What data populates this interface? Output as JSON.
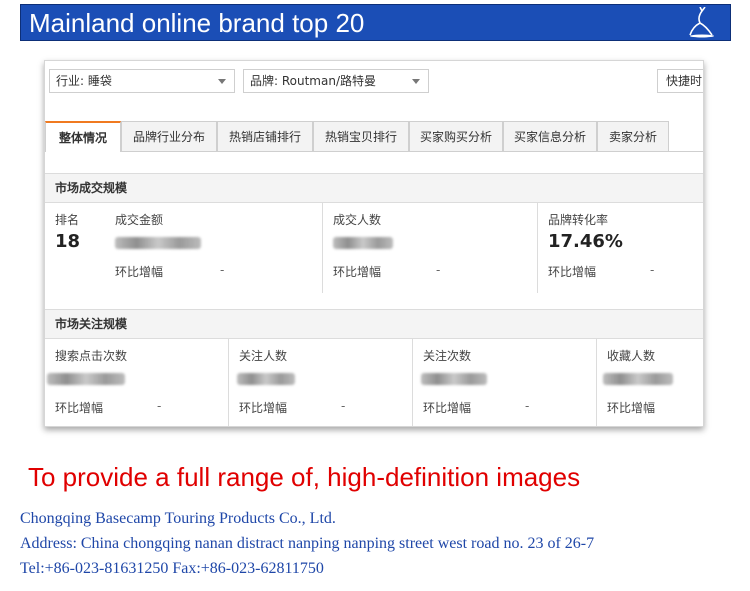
{
  "banner": {
    "title": "Mainland online brand top 20",
    "logo_icon": "deer-logo-icon"
  },
  "filters": {
    "industry": "行业: 睡袋",
    "brand": "品牌: Routman/路特曼",
    "quick": "快捷时"
  },
  "tabs": [
    {
      "label": "整体情况",
      "active": true
    },
    {
      "label": "品牌行业分布"
    },
    {
      "label": "热销店铺排行"
    },
    {
      "label": "热销宝贝排行"
    },
    {
      "label": "买家购买分析"
    },
    {
      "label": "买家信息分析"
    },
    {
      "label": "卖家分析"
    }
  ],
  "market_scale": {
    "title": "市场成交规模",
    "rank_label": "排名",
    "rank_value": "18",
    "metrics": [
      {
        "label": "成交金额",
        "value": "",
        "foot": "环比增幅",
        "change": "-"
      },
      {
        "label": "成交人数",
        "value": "",
        "foot": "环比增幅",
        "change": "-"
      },
      {
        "label": "品牌转化率",
        "value": "17.46%",
        "foot": "环比增幅",
        "change": "-"
      }
    ]
  },
  "attention_scale": {
    "title": "市场关注规模",
    "metrics": [
      {
        "label": "搜索点击次数",
        "foot": "环比增幅",
        "change": "-"
      },
      {
        "label": "关注人数",
        "foot": "环比增幅",
        "change": "-"
      },
      {
        "label": "关注次数",
        "foot": "环比增幅",
        "change": "-"
      },
      {
        "label": "收藏人数",
        "foot": "环比增幅"
      }
    ]
  },
  "footer": {
    "headline": "To provide a full range of, high-definition images",
    "company": "Chongqing Basecamp Touring Products Co., Ltd.",
    "address": "Address: China chongqing nanan distract nanping nanping street west road no. 23 of 26-7",
    "contact": "Tel:+86-023-81631250    Fax:+86-023-62811750"
  },
  "colors": {
    "banner": "#1b4eb6",
    "headline": "#e00000",
    "company": "#1f47a8",
    "tab_accent": "#f07a20"
  }
}
